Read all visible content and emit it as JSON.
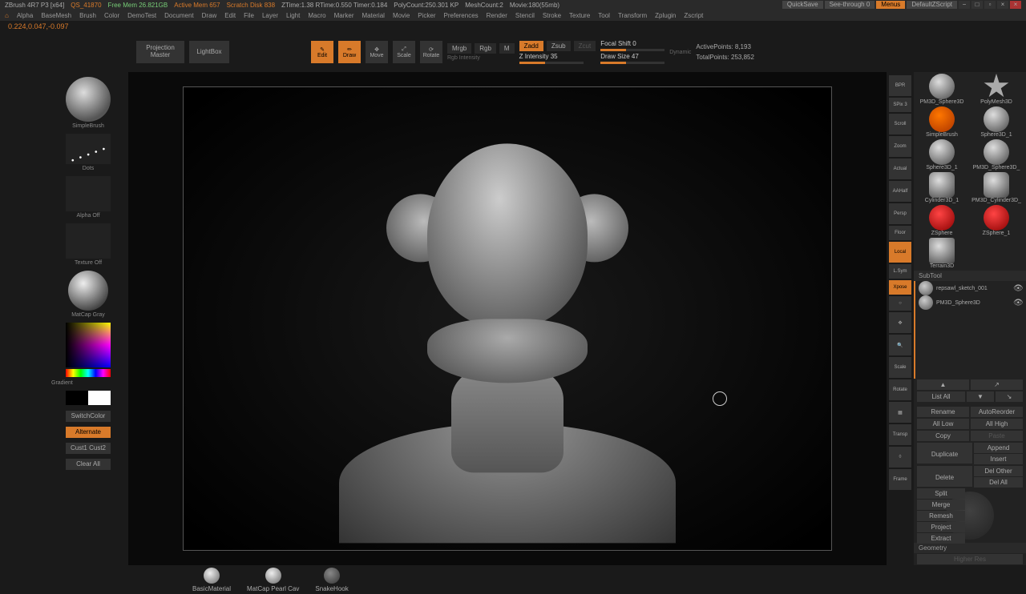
{
  "titlebar": {
    "app": "ZBrush 4R7 P3 [x64]",
    "qs": "QS_41870",
    "freeMem": "Free Mem 26.821GB",
    "activeMem": "Active Mem 657",
    "scratch": "Scratch Disk 838",
    "ztime": "ZTime:1.38 RTime:0.550 Timer:0.184",
    "poly": "PolyCount:250.301 KP",
    "mesh": "MeshCount:2",
    "movie": "Movie:180(55mb)",
    "quicksave": "QuickSave",
    "seethru": "See-through  0",
    "menus": "Menus",
    "script": "DefaultZScript"
  },
  "menu": [
    "Alpha",
    "BaseMesh",
    "Brush",
    "Color",
    "DemoTest",
    "Document",
    "Draw",
    "Edit",
    "File",
    "Layer",
    "Light",
    "Macro",
    "Marker",
    "Material",
    "Movie",
    "Picker",
    "Preferences",
    "Render",
    "Stencil",
    "Stroke",
    "Texture",
    "Tool",
    "Transform",
    "Zplugin",
    "Zscript"
  ],
  "coords": "0.224,0.047,-0.097",
  "topbar": {
    "proj": "Projection Master",
    "lightbox": "LightBox",
    "edit": "Edit",
    "draw": "Draw",
    "move": "Move",
    "scale": "Scale",
    "rotate": "Rotate",
    "mrgb": "Mrgb",
    "rgb": "Rgb",
    "m": "M",
    "zadd": "Zadd",
    "zsub": "Zsub",
    "zcut": "Zcut",
    "rgbint": "Rgb Intensity",
    "focal": "Focal Shift 0",
    "zint": "Z Intensity 35",
    "drawsize": "Draw Size 47",
    "dynamic": "Dynamic",
    "active": "ActivePoints: 8,193",
    "total": "TotalPoints: 253,852"
  },
  "left": {
    "brush": "SimpleBrush",
    "stroke": "Dots",
    "alpha": "Alpha Off",
    "texture": "Texture Off",
    "material": "MatCap Gray",
    "gradient": "Gradient",
    "switch": "SwitchColor",
    "alternate": "Alternate",
    "cust": "Cust1 Cust2",
    "clear": "Clear All"
  },
  "righticons": [
    "BPR",
    "SPix 3",
    "Scroll",
    "Zoom",
    "Actual",
    "AAHalf",
    "Persp",
    "Floor",
    "Local",
    "L.Sym",
    "Xpose",
    "",
    "",
    "",
    "Scale",
    "Rotate",
    "",
    "Transp",
    "",
    "Frame"
  ],
  "tools": [
    {
      "name": "PM3D_Sphere3D"
    },
    {
      "name": "PolyMesh3D"
    },
    {
      "name": "SimpleBrush"
    },
    {
      "name": "Sphere3D_1"
    },
    {
      "name": "Sphere3D_1"
    },
    {
      "name": "PM3D_Sphere3D_"
    },
    {
      "name": "Cylinder3D_1"
    },
    {
      "name": "PM3D_Cylinder3D_"
    },
    {
      "name": "ZSphere"
    },
    {
      "name": "ZSphere_1"
    },
    {
      "name": "Terrain3D"
    }
  ],
  "subtool": {
    "header": "SubTool",
    "items": [
      {
        "name": "repsawl_sketch_001"
      },
      {
        "name": "PM3D_Sphere3D"
      }
    ],
    "listAll": "List All",
    "rename": "Rename",
    "autoreorder": "AutoReorder",
    "alllow": "All Low",
    "allhigh": "All High",
    "copy": "Copy",
    "paste": "Paste",
    "duplicate": "Duplicate",
    "append": "Append",
    "insert": "Insert",
    "delete": "Delete",
    "delother": "Del Other",
    "delall": "Del All",
    "split": "Split",
    "merge": "Merge",
    "remesh": "Remesh",
    "project": "Project",
    "extract": "Extract",
    "geometry": "Geometry",
    "higherres": "Higher Res"
  },
  "shelf": [
    {
      "name": "BasicMaterial"
    },
    {
      "name": "MatCap Pearl Cav"
    },
    {
      "name": "SnakeHook"
    }
  ]
}
